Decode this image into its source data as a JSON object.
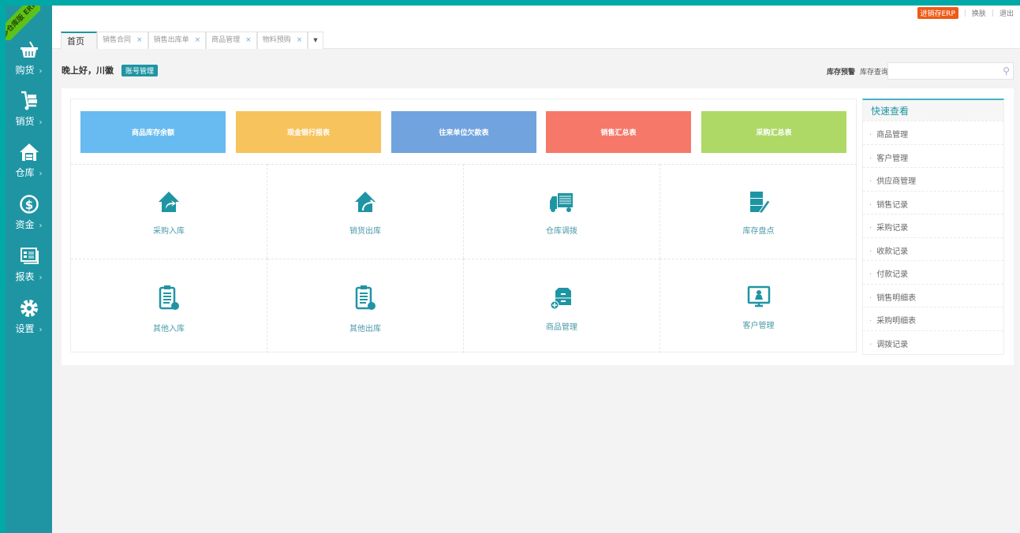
{
  "brand": {
    "ribbon": "多仓库版 ERP"
  },
  "sidebar": [
    {
      "label": "购货",
      "icon": "basket-icon"
    },
    {
      "label": "销货",
      "icon": "cart-icon"
    },
    {
      "label": "仓库",
      "icon": "warehouse-icon"
    },
    {
      "label": "资金",
      "icon": "dollar-icon"
    },
    {
      "label": "报表",
      "icon": "report-icon"
    },
    {
      "label": "设置",
      "icon": "gear-icon"
    }
  ],
  "header": {
    "erp_badge": "进销存ERP",
    "skin": "换肤",
    "logout": "退出"
  },
  "tabs": [
    {
      "label": "首页"
    },
    {
      "label": "销售合同"
    },
    {
      "label": "销售出库单"
    },
    {
      "label": "商品管理"
    },
    {
      "label": "物料预购"
    }
  ],
  "greeting": {
    "text": "晚上好，川徽",
    "account": "账号管理"
  },
  "stock": {
    "warning": "库存预警",
    "query": "库存查询",
    "placeholder": ""
  },
  "tiles": [
    {
      "label": "商品库存余额",
      "color": "#68bbf0"
    },
    {
      "label": "现金银行报表",
      "color": "#f6c35c"
    },
    {
      "label": "往来单位欠款表",
      "color": "#71a3de"
    },
    {
      "label": "销售汇总表",
      "color": "#f67868"
    },
    {
      "label": "采购汇总表",
      "color": "#aed966"
    }
  ],
  "shortcuts": [
    {
      "label": "采购入库"
    },
    {
      "label": "销货出库"
    },
    {
      "label": "仓库调拨"
    },
    {
      "label": "库存盘点"
    },
    {
      "label": "其他入库"
    },
    {
      "label": "其他出库"
    },
    {
      "label": "商品管理"
    },
    {
      "label": "客户管理"
    }
  ],
  "quick": {
    "title": "快速查看",
    "items": [
      "商品管理",
      "客户管理",
      "供应商管理",
      "销售记录",
      "采购记录",
      "收款记录",
      "付款记录",
      "销售明细表",
      "采购明细表",
      "调拨记录"
    ]
  }
}
